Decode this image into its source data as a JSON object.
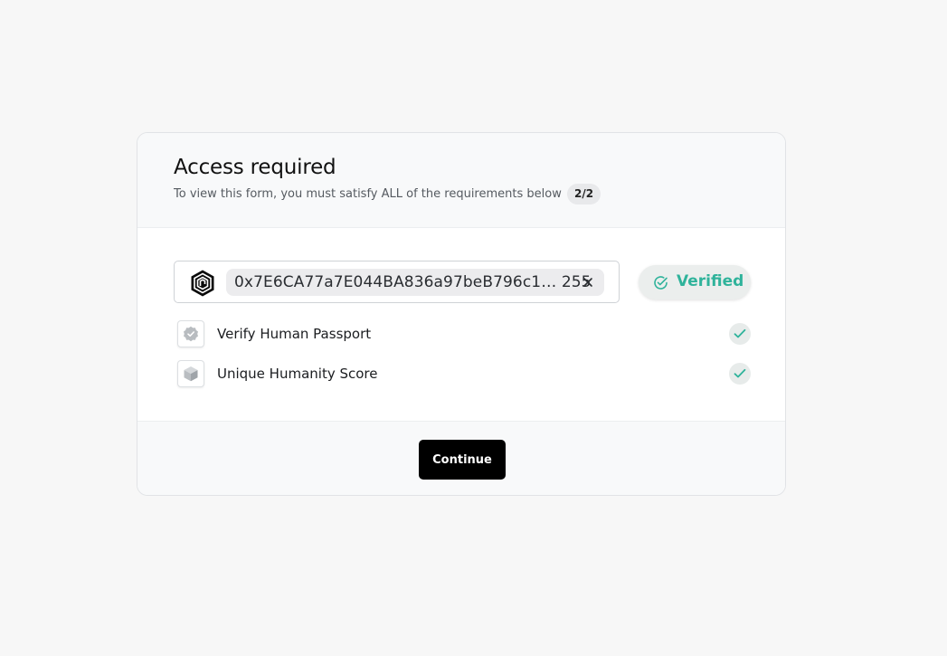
{
  "header": {
    "title": "Access required",
    "subtitle": "To view this form, you must satisfy ALL of the requirements below",
    "progress_badge": "2/2"
  },
  "wallet": {
    "logo_icon": "human-passport-logo-icon",
    "address": "0x7E6CA77a7E044BA836a97beB796c1… 255",
    "remove_icon": "close-icon"
  },
  "status": {
    "label": "Verified",
    "icon": "check-circle-icon",
    "color": "#2fb39b"
  },
  "requirements": [
    {
      "label": "Verify Human Passport",
      "icon": "shield-badge-icon",
      "completed": true
    },
    {
      "label": "Unique Humanity Score",
      "icon": "cube-icon",
      "completed": true
    }
  ],
  "footer": {
    "continue_label": "Continue"
  },
  "colors": {
    "background": "#f7f7f7",
    "accent": "#2fb39b",
    "primary_button": "#000000"
  }
}
